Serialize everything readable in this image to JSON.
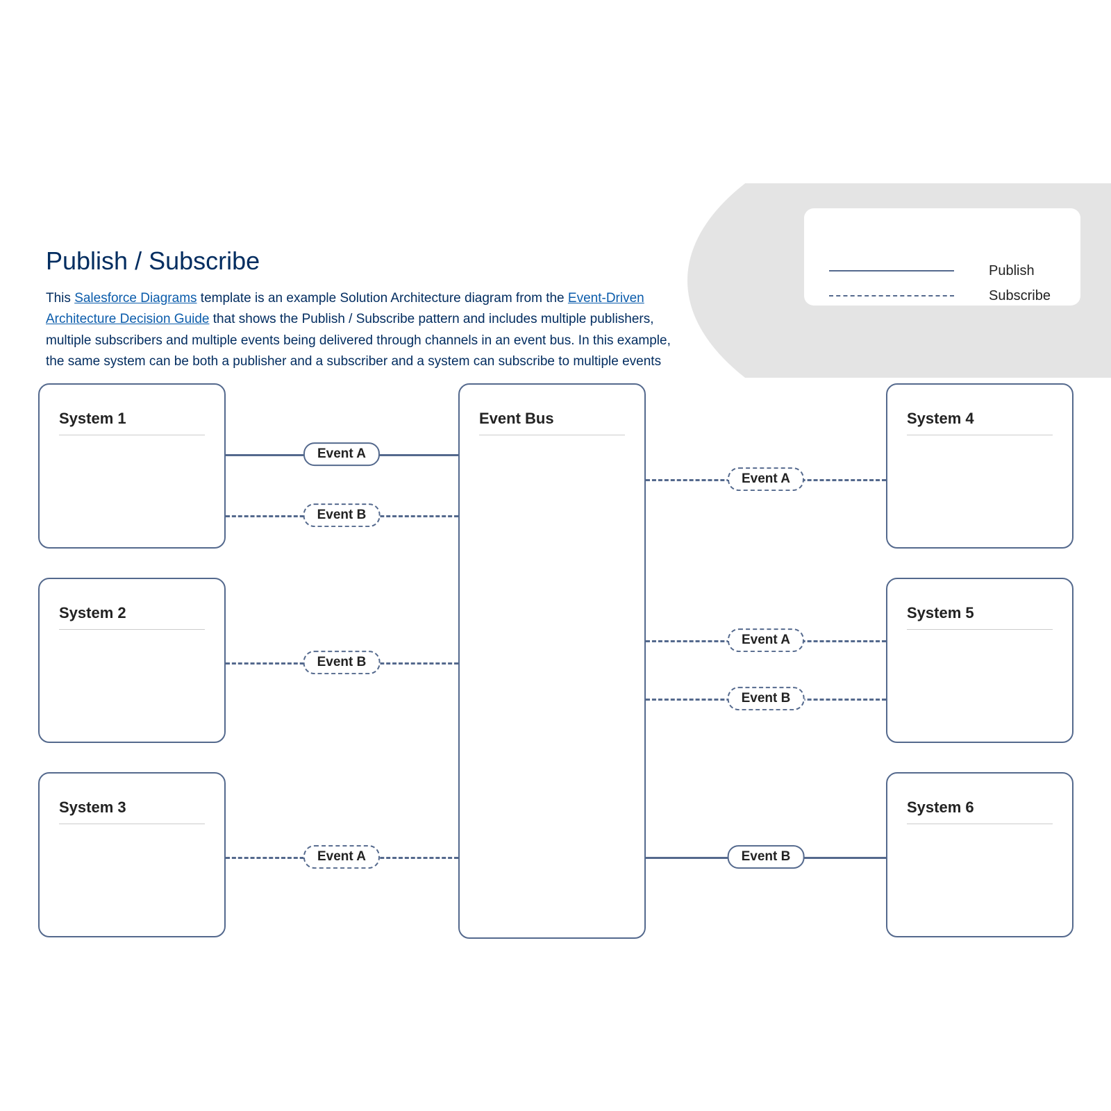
{
  "title": "Publish / Subscribe",
  "description": {
    "pre": "This ",
    "link1": "Salesforce Diagrams",
    "mid1": " template is an example Solution Architecture diagram from the ",
    "link2": "Event-Driven Architecture Decision Guide",
    "mid2": " that shows the Publish / Subscribe pattern and includes multiple publishers, multiple subscribers and multiple events being delivered through channels in an event bus. In this example, the same system can be both a publisher and a subscriber and a system can subscribe to multiple events"
  },
  "legend": {
    "publish": "Publish",
    "subscribe": "Subscribe"
  },
  "nodes": {
    "eventBus": "Event Bus",
    "system1": "System 1",
    "system2": "System 2",
    "system3": "System 3",
    "system4": "System 4",
    "system5": "System 5",
    "system6": "System 6"
  },
  "edges": {
    "s1_pub": {
      "label": "Event A",
      "type": "publish",
      "from": "system1",
      "to": "eventBus"
    },
    "s1_sub": {
      "label": "Event B",
      "type": "subscribe",
      "from": "system1",
      "to": "eventBus"
    },
    "s2_sub": {
      "label": "Event B",
      "type": "subscribe",
      "from": "system2",
      "to": "eventBus"
    },
    "s3_sub": {
      "label": "Event A",
      "type": "subscribe",
      "from": "system3",
      "to": "eventBus"
    },
    "s4_sub": {
      "label": "Event A",
      "type": "subscribe",
      "from": "eventBus",
      "to": "system4"
    },
    "s5_subA": {
      "label": "Event A",
      "type": "subscribe",
      "from": "eventBus",
      "to": "system5"
    },
    "s5_subB": {
      "label": "Event B",
      "type": "subscribe",
      "from": "eventBus",
      "to": "system5"
    },
    "s6_pub": {
      "label": "Event B",
      "type": "publish",
      "from": "eventBus",
      "to": "system6"
    }
  }
}
